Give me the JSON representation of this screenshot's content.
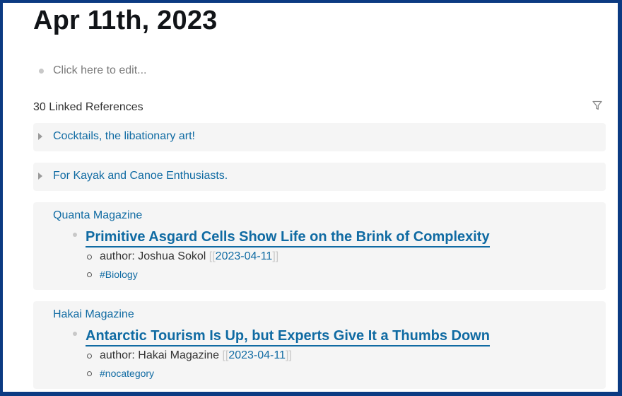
{
  "page": {
    "title": "Apr 11th, 2023"
  },
  "editor": {
    "placeholder": "Click here to edit..."
  },
  "linked_refs": {
    "count_label": "30 Linked References",
    "filter_icon": "filter-icon",
    "collapsed": [
      {
        "title": "Cocktails, the libationary art!"
      },
      {
        "title": "For Kayak and Canoe Enthusiasts."
      }
    ],
    "expanded": [
      {
        "source": "Quanta Magazine",
        "article": "Primitive Asgard Cells Show Life on the Brink of Complexity",
        "author_prefix": "author: Joshua Sokol",
        "open_bracket": "[[",
        "date_link": "2023-04-11",
        "close_bracket": "]]",
        "tag": "#Biology"
      },
      {
        "source": "Hakai Magazine",
        "article": "Antarctic Tourism Is Up, but Experts Give It a Thumbs Down",
        "author_prefix": "author: Hakai Magazine",
        "open_bracket": "[[",
        "date_link": "2023-04-11",
        "close_bracket": "]]",
        "tag": "#nocategory"
      }
    ]
  },
  "colors": {
    "link": "#106ba3",
    "frame": "#0b3a82",
    "block_bg": "#f5f5f5"
  }
}
